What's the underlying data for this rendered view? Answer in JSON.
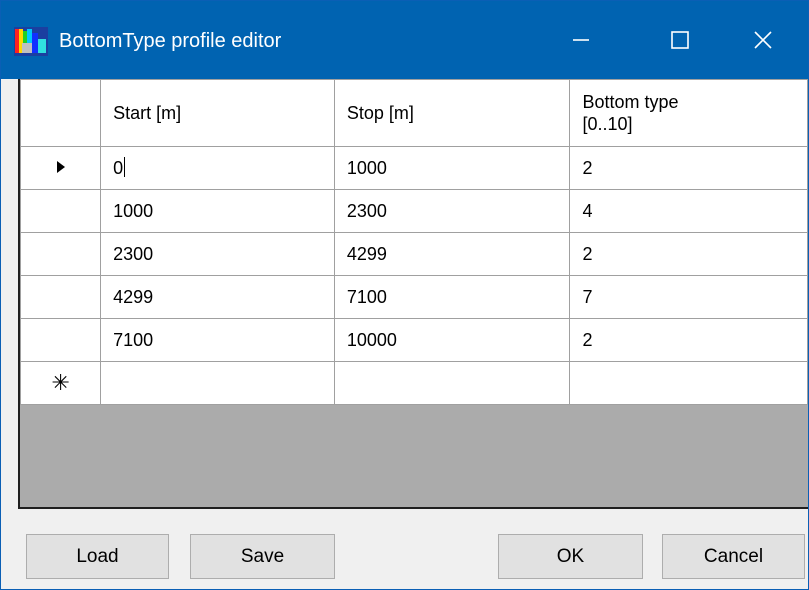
{
  "window": {
    "title": "BottomType profile editor",
    "icon": "app-icon",
    "controls": [
      "minimize-icon",
      "maximize-icon",
      "close-icon"
    ]
  },
  "grid": {
    "columns": [
      "Start [m]",
      "Stop [m]",
      "Bottom type\n[0..10]"
    ],
    "rows": [
      {
        "indicator": "▶",
        "start": "0",
        "stop": "1000",
        "type": "2"
      },
      {
        "indicator": "",
        "start": "1000",
        "stop": "2300",
        "type": "4"
      },
      {
        "indicator": "",
        "start": "2300",
        "stop": "4299",
        "type": "2"
      },
      {
        "indicator": "",
        "start": "4299",
        "stop": "7100",
        "type": "7"
      },
      {
        "indicator": "",
        "start": "7100",
        "stop": "10000",
        "type": "2"
      }
    ],
    "new_row_indicator": "✳"
  },
  "buttons": {
    "load": "Load",
    "save": "Save",
    "ok": "OK",
    "cancel": "Cancel"
  },
  "colors": {
    "titlebar": "#0063b1",
    "grid_background": "#ababab"
  }
}
